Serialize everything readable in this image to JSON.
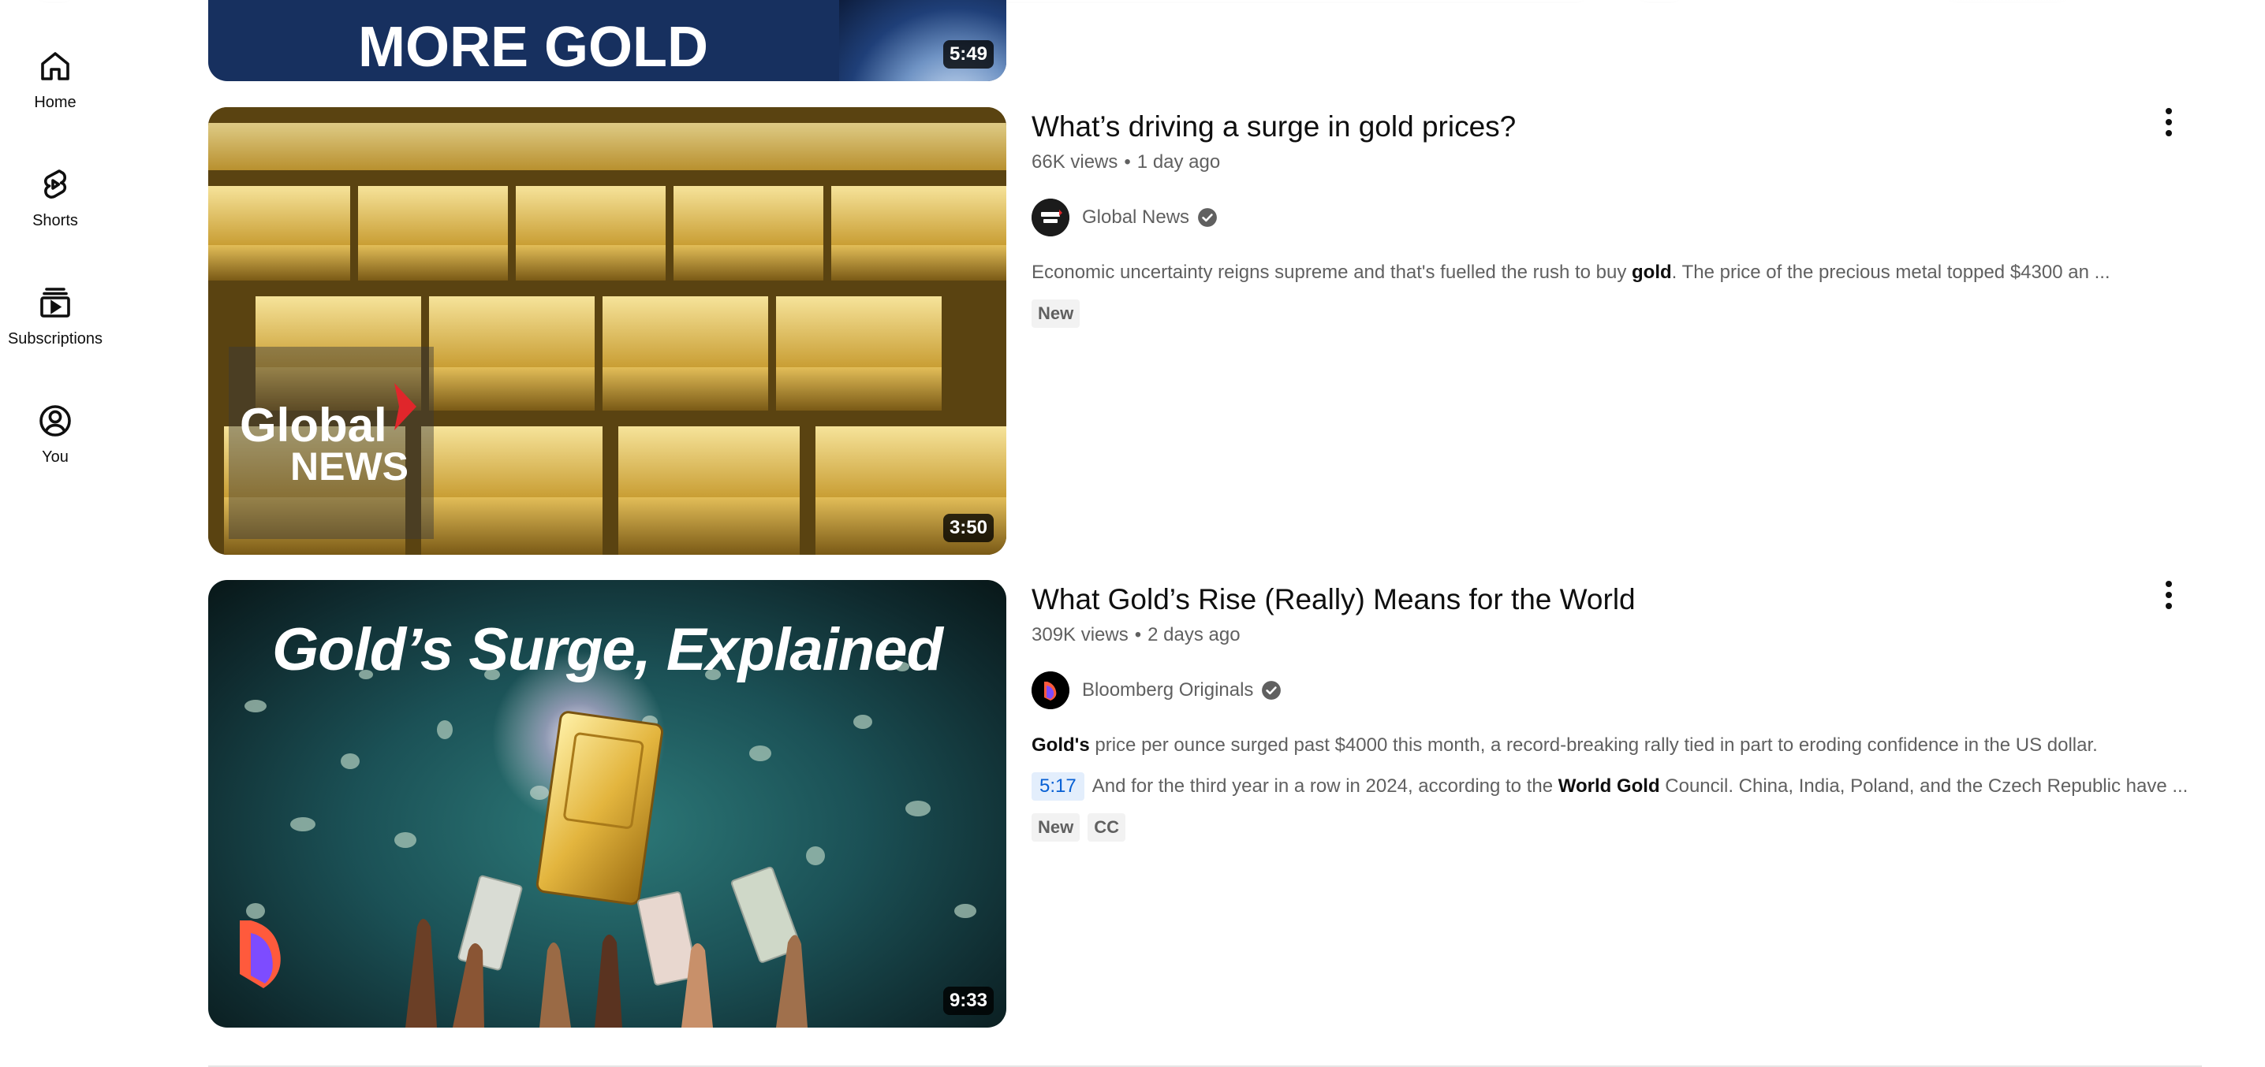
{
  "guide": {
    "home": {
      "label": "Home",
      "icon": "home-icon"
    },
    "shorts": {
      "label": "Shorts",
      "icon": "shorts-icon"
    },
    "subscriptions": {
      "label": "Subscriptions",
      "icon": "subscriptions-icon"
    },
    "you": {
      "label": "You",
      "icon": "account-icon"
    }
  },
  "results": [
    {
      "thumbnail_text": "MORE GOLD",
      "duration": "5:49"
    },
    {
      "title": "What’s driving a surge in gold prices?",
      "views": "66K views",
      "age": "1 day ago",
      "channel": "Global News",
      "verified": true,
      "snippet_pre": "Economic uncertainty reigns supreme and that's fuelled the rush to buy ",
      "snippet_bold": "gold",
      "snippet_post": ". The price of the precious metal topped $4300 an ...",
      "badges": [
        "New"
      ],
      "thumbnail_logo_top": "Global",
      "thumbnail_logo_bottom": "NEWS",
      "duration": "3:50"
    },
    {
      "title": "What Gold’s Rise (Really) Means for the World",
      "views": "309K views",
      "age": "2 days ago",
      "channel": "Bloomberg Originals",
      "verified": true,
      "snippet1_bold": "Gold's",
      "snippet1_rest": " price per ounce surged past $4000 this month, a record-breaking rally tied in part to eroding confidence in the US dollar.",
      "chapter_timestamp": "5:17",
      "snippet2_pre": "And for the third year in a row in 2024, according to the ",
      "snippet2_bold": "World Gold",
      "snippet2_post": " Council. China, India, Poland, and the Czech Republic have ...",
      "badges": [
        "New",
        "CC"
      ],
      "thumbnail_text": "Gold’s Surge, Explained",
      "duration": "9:33"
    }
  ],
  "colors": {
    "link_blue": "#065fd4",
    "meta_gray": "#606060",
    "badge_bg": "#f2f2f2",
    "global_news_red": "#e0262b",
    "thumb_navy": "#17305f"
  }
}
